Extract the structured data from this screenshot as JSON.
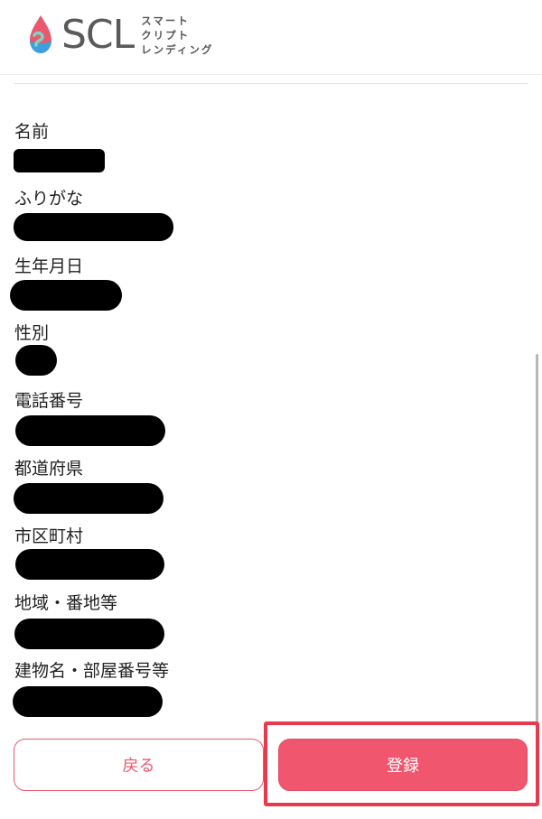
{
  "header": {
    "logo_text": "SCL",
    "logo_sub_lines": [
      "スマート",
      "クリプト",
      "レンディング"
    ]
  },
  "fields": [
    {
      "label": "名前"
    },
    {
      "label": "ふりがな"
    },
    {
      "label": "生年月日"
    },
    {
      "label": "性別"
    },
    {
      "label": "電話番号"
    },
    {
      "label": "都道府県"
    },
    {
      "label": "市区町村"
    },
    {
      "label": "地域・番地等"
    },
    {
      "label": "建物名・部屋番号等"
    }
  ],
  "actions": {
    "back_label": "戻る",
    "register_label": "登録"
  },
  "colors": {
    "accent": "#f0566d",
    "highlight": "#e8394e",
    "logo_text": "#5a5a5a",
    "logo_drop_top": "#e8596e",
    "logo_drop_bottom": "#3aa0e0",
    "logo_drop_mid": "#7fd3c4"
  }
}
